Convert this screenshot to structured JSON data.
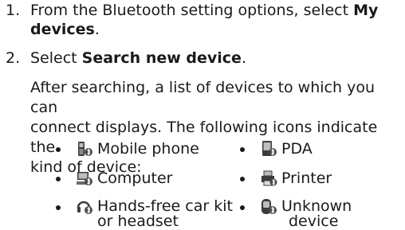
{
  "steps": [
    {
      "number": "1.",
      "line1_pre": "From the Bluetooth setting options, select ",
      "line1_bold": "My",
      "line2_bold": "devices",
      "line2_post": "."
    },
    {
      "number": "2.",
      "pre": "Select ",
      "bold": "Search new device",
      "post": "."
    }
  ],
  "paragraph": [
    "After searching, a list of devices to which you can",
    "connect displays. The following icons indicate the",
    "kind of device:"
  ],
  "device_types": [
    {
      "icon": "mobile-phone-icon",
      "label": "Mobile phone"
    },
    {
      "icon": "pda-icon",
      "label": "PDA"
    },
    {
      "icon": "computer-icon",
      "label": "Computer"
    },
    {
      "icon": "printer-icon",
      "label": "Printer"
    },
    {
      "icon": "headset-icon",
      "label": "Hands-free car kit",
      "label2": "or headset"
    },
    {
      "icon": "unknown-device-icon",
      "label": "Unknown",
      "label2": "device"
    }
  ],
  "colors": {
    "text": "#1a1a1a",
    "icon_dark": "#3c3c3c",
    "icon_light": "#bdbdbd"
  }
}
